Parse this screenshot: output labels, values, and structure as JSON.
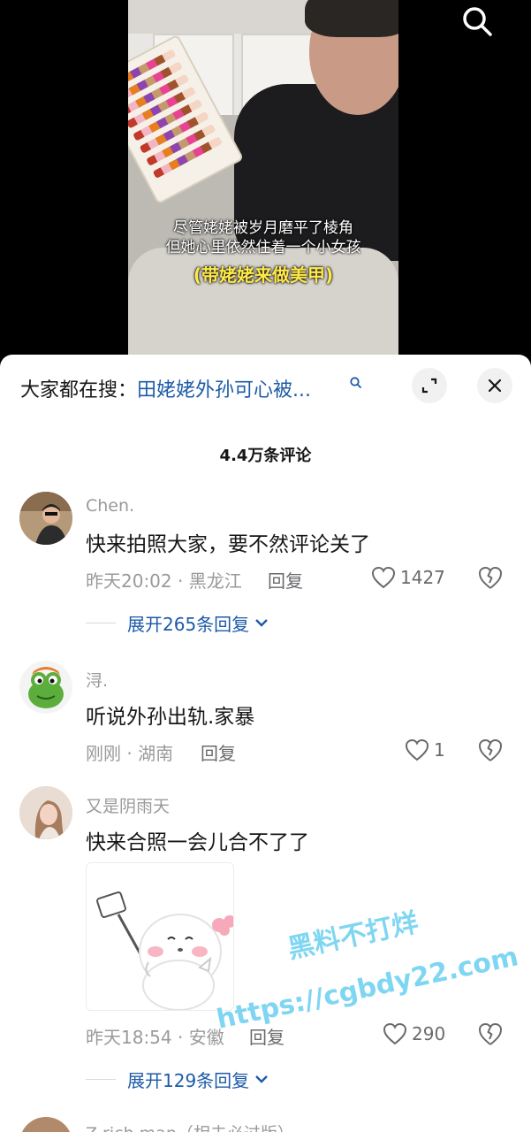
{
  "video": {
    "subtitle_line1": "尽管姥姥被岁月磨平了棱角",
    "subtitle_line2": "但她心里依然住着一个小女孩",
    "subtitle_highlight": "(带姥姥来做美甲)"
  },
  "top_icons": {
    "search": "search-icon"
  },
  "panel": {
    "suggest_prefix": "大家都在搜：",
    "suggest_query": "田姥姥外孙可心被...",
    "expand_icon": "expand-icon",
    "close_icon": "close-icon",
    "comment_count": "4.4万条评论"
  },
  "comments": [
    {
      "user": "Chen.",
      "text": "快来拍照大家，要不然评论关了",
      "meta": "昨天20:02 · 黑龙江",
      "reply": "回复",
      "likes": "1427",
      "expand": "展开265条回复"
    },
    {
      "user": "浔.",
      "text": "听说外孙出轨.家暴",
      "meta": "刚刚 · 湖南",
      "reply": "回复",
      "likes": "1"
    },
    {
      "user": "又是阴雨天",
      "text": "快来合照一会儿合不了了",
      "meta": "昨天18:54 · 安徽",
      "reply": "回复",
      "likes": "290",
      "expand": "展开129条回复"
    },
    {
      "user": "Z rich man（相去必过版）"
    }
  ],
  "watermark": {
    "line1": "黑料不打烊",
    "line2": "https://cgbdy22.com"
  },
  "colors": {
    "link": "#1d5ba8",
    "muted": "#9a9a9d",
    "text": "#161616",
    "subtitle_yellow": "#ffe94a",
    "watermark": "#7fd6f2"
  }
}
